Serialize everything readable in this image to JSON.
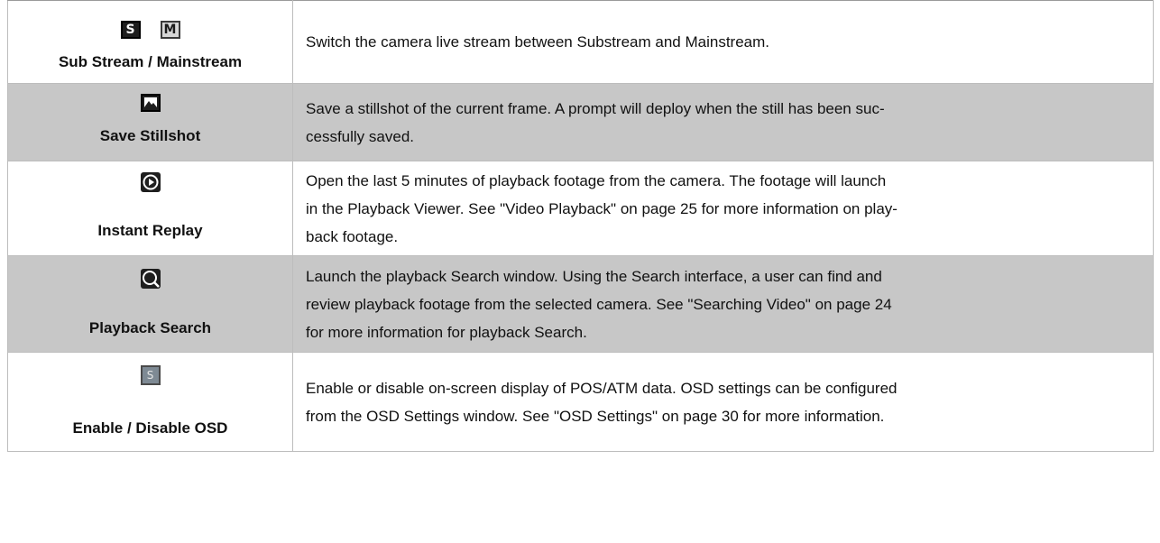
{
  "rows": [
    {
      "icons": [
        {
          "name": "s-stream-icon",
          "glyph": "S"
        },
        {
          "name": "m-stream-icon",
          "glyph": "M"
        }
      ],
      "label": "Sub Stream / Mainstream",
      "desc_lines": [
        "Switch the camera live stream between Substream and Mainstream."
      ]
    },
    {
      "icons": [
        {
          "name": "stillshot-icon"
        }
      ],
      "label": "Save Stillshot",
      "desc_lines": [
        "Save a stillshot of the current frame. A prompt will deploy when the still has been suc-",
        "cessfully saved."
      ]
    },
    {
      "icons": [
        {
          "name": "instant-replay-icon"
        }
      ],
      "label": "Instant Replay",
      "desc_lines": [
        "Open the last 5 minutes of playback footage from the camera. The footage will launch",
        "in the Playback Viewer. See \"Video Playback\" on page 25 for more information on play-",
        "back footage."
      ]
    },
    {
      "icons": [
        {
          "name": "playback-search-icon"
        }
      ],
      "label": "Playback Search",
      "desc_lines": [
        "Launch the playback Search window. Using the Search interface, a user can find and",
        "review playback footage from the selected camera. See \"Searching Video\" on page 24",
        "for more information for playback Search."
      ]
    },
    {
      "icons": [
        {
          "name": "osd-icon",
          "glyph": "S"
        }
      ],
      "label": "Enable / Disable OSD",
      "desc_lines": [
        "Enable or disable on-screen display of POS/ATM data. OSD settings can be configured",
        "from the OSD Settings window. See \"OSD Settings\" on page 30 for more information."
      ]
    }
  ]
}
